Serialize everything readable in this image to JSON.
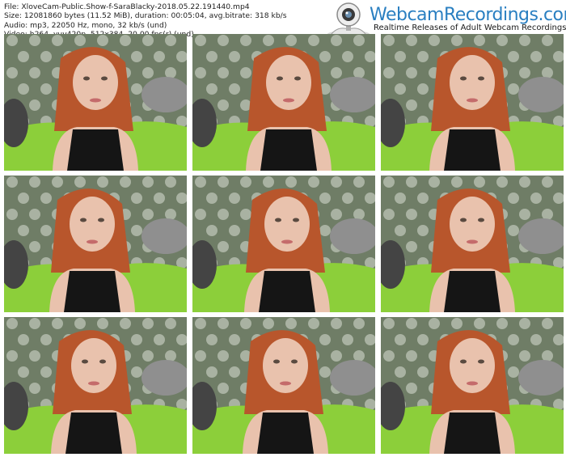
{
  "info": {
    "file_line": "File: XloveCam-Public.Show-f-SaraBlacky-2018.05.22.191440.mp4",
    "size_line": "Size: 12081860 bytes (11.52 MiB), duration: 00:05:04, avg.bitrate: 318 kb/s",
    "audio_line": "Audio: mp3, 22050 Hz, mono, 32 kb/s (und)",
    "video_line": "Video: h264, yuv420p, 512x384, 20.00 fps(r) (und)"
  },
  "logo": {
    "title": "WebcamRecordings.com",
    "subtitle": "Realtime Releases of Adult Webcam Recordings",
    "icon": "webcam-icon"
  },
  "thumbnails": {
    "count": 9,
    "colors": {
      "wall": "#6f7d66",
      "bed": "#8ccf3a",
      "hair": "#b8562c",
      "skin": "#e9c2ad",
      "top": "#151515",
      "pillow": "#8f8f8f"
    }
  }
}
